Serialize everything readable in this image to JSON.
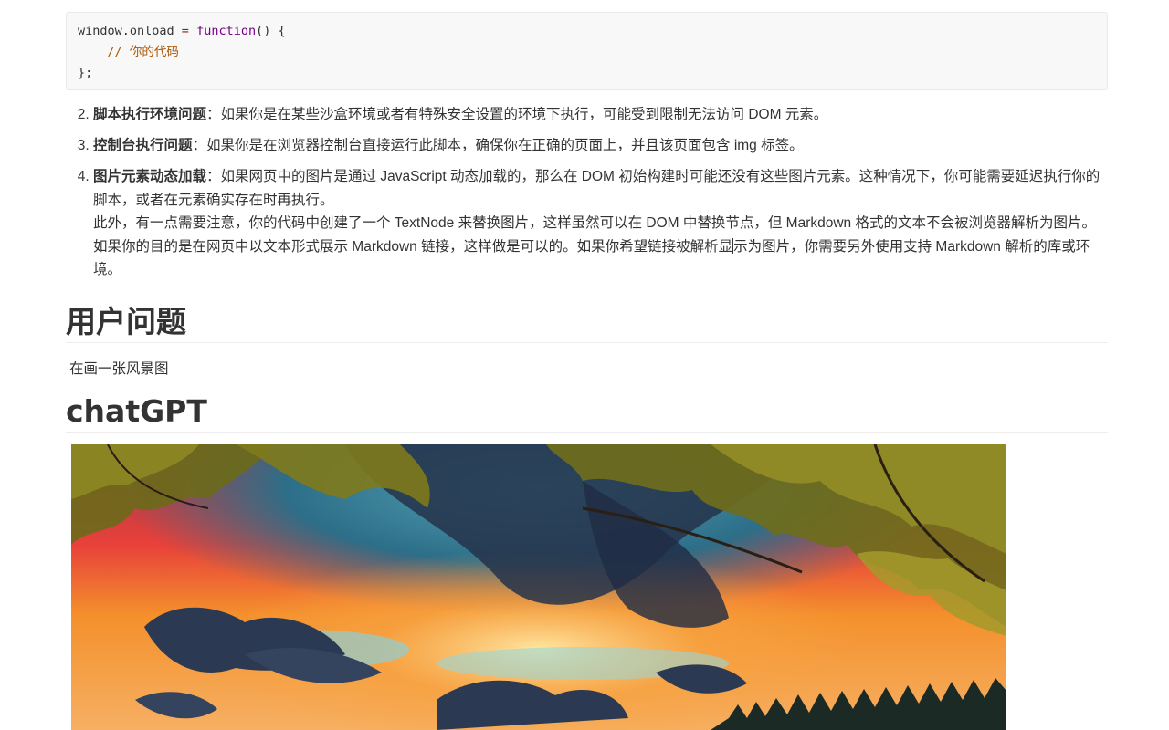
{
  "code_block": {
    "line1": {
      "obj": "window.onload",
      "op": " = ",
      "kw": "function",
      "rest": "() {"
    },
    "line2": {
      "indent": "    ",
      "comment": "// 你的代码"
    },
    "line3": "};"
  },
  "steps": [
    {
      "number": 2,
      "bold": "脚本执行环境问题",
      "text": "：如果你是在某些沙盒环境或者有特殊安全设置的环境下执行，可能受到限制无法访问 DOM 元素。"
    },
    {
      "number": 3,
      "bold": "控制台执行问题",
      "text": "：如果你是在浏览器控制台直接运行此脚本，确保你在正确的页面上，并且该页面包含 img 标签。"
    },
    {
      "number": 4,
      "bold": "图片元素动态加载",
      "text": "：如果网页中的图片是通过 JavaScript 动态加载的，那么在 DOM 初始构建时可能还没有这些图片元素。这种情况下，你可能需要延迟执行你的脚本，或者在元素确实存在时再执行。",
      "extra_before_cursor": "此外，有一点需要注意，你的代码中创建了一个 TextNode 来替换图片，这样虽然可以在 DOM 中替换节点，但 Markdown 格式的文本不会被浏览器解析为图片。如果你的目的是在网页中以文本形式展示 Markdown 链接，这样做是可以的。如果你希望链接被解析显",
      "extra_after_cursor": "示为图片，你需要另外使用支持 Markdown 解析的库或环境。"
    }
  ],
  "user_section": {
    "heading": "用户问题",
    "question": "在画一张风景图"
  },
  "gpt_section": {
    "heading": "chatGPT"
  },
  "image": {
    "subject": "sunset-landscape-image",
    "colors": {
      "sky_red": "#e8413a",
      "sky_orange": "#f4902c",
      "cloud_dark": "#2b3a52",
      "teal": "#2d6e88",
      "foliage": "#7f7a1c"
    }
  }
}
